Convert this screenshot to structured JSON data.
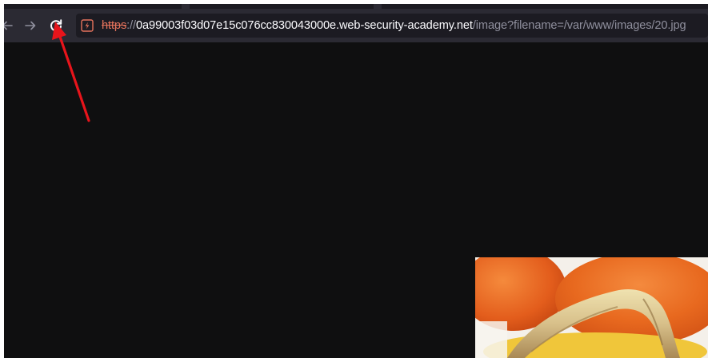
{
  "toolbar": {
    "back_icon": "arrow-left-icon",
    "forward_icon": "arrow-right-icon",
    "reload_icon": "reload-icon"
  },
  "urlbar": {
    "site_icon": "insecure-site-icon",
    "scheme": "https",
    "separator": "://",
    "host": "0a99003f03d07e15c076cc830043000e.web-security-academy.net",
    "path": "/image?filename=/var/www/images/20.jpg"
  },
  "content": {
    "image_description_icon": "fruit-image"
  },
  "annotation": {
    "color": "#e8141b",
    "target": "reload-button"
  },
  "colors": {
    "toolbar_bg": "#2b2a33",
    "urlbar_bg": "#1c1b22",
    "page_bg": "#0f0f10",
    "scheme_color": "#e5735c",
    "host_color": "#fbfbfe",
    "path_color": "#8f8f9d"
  }
}
